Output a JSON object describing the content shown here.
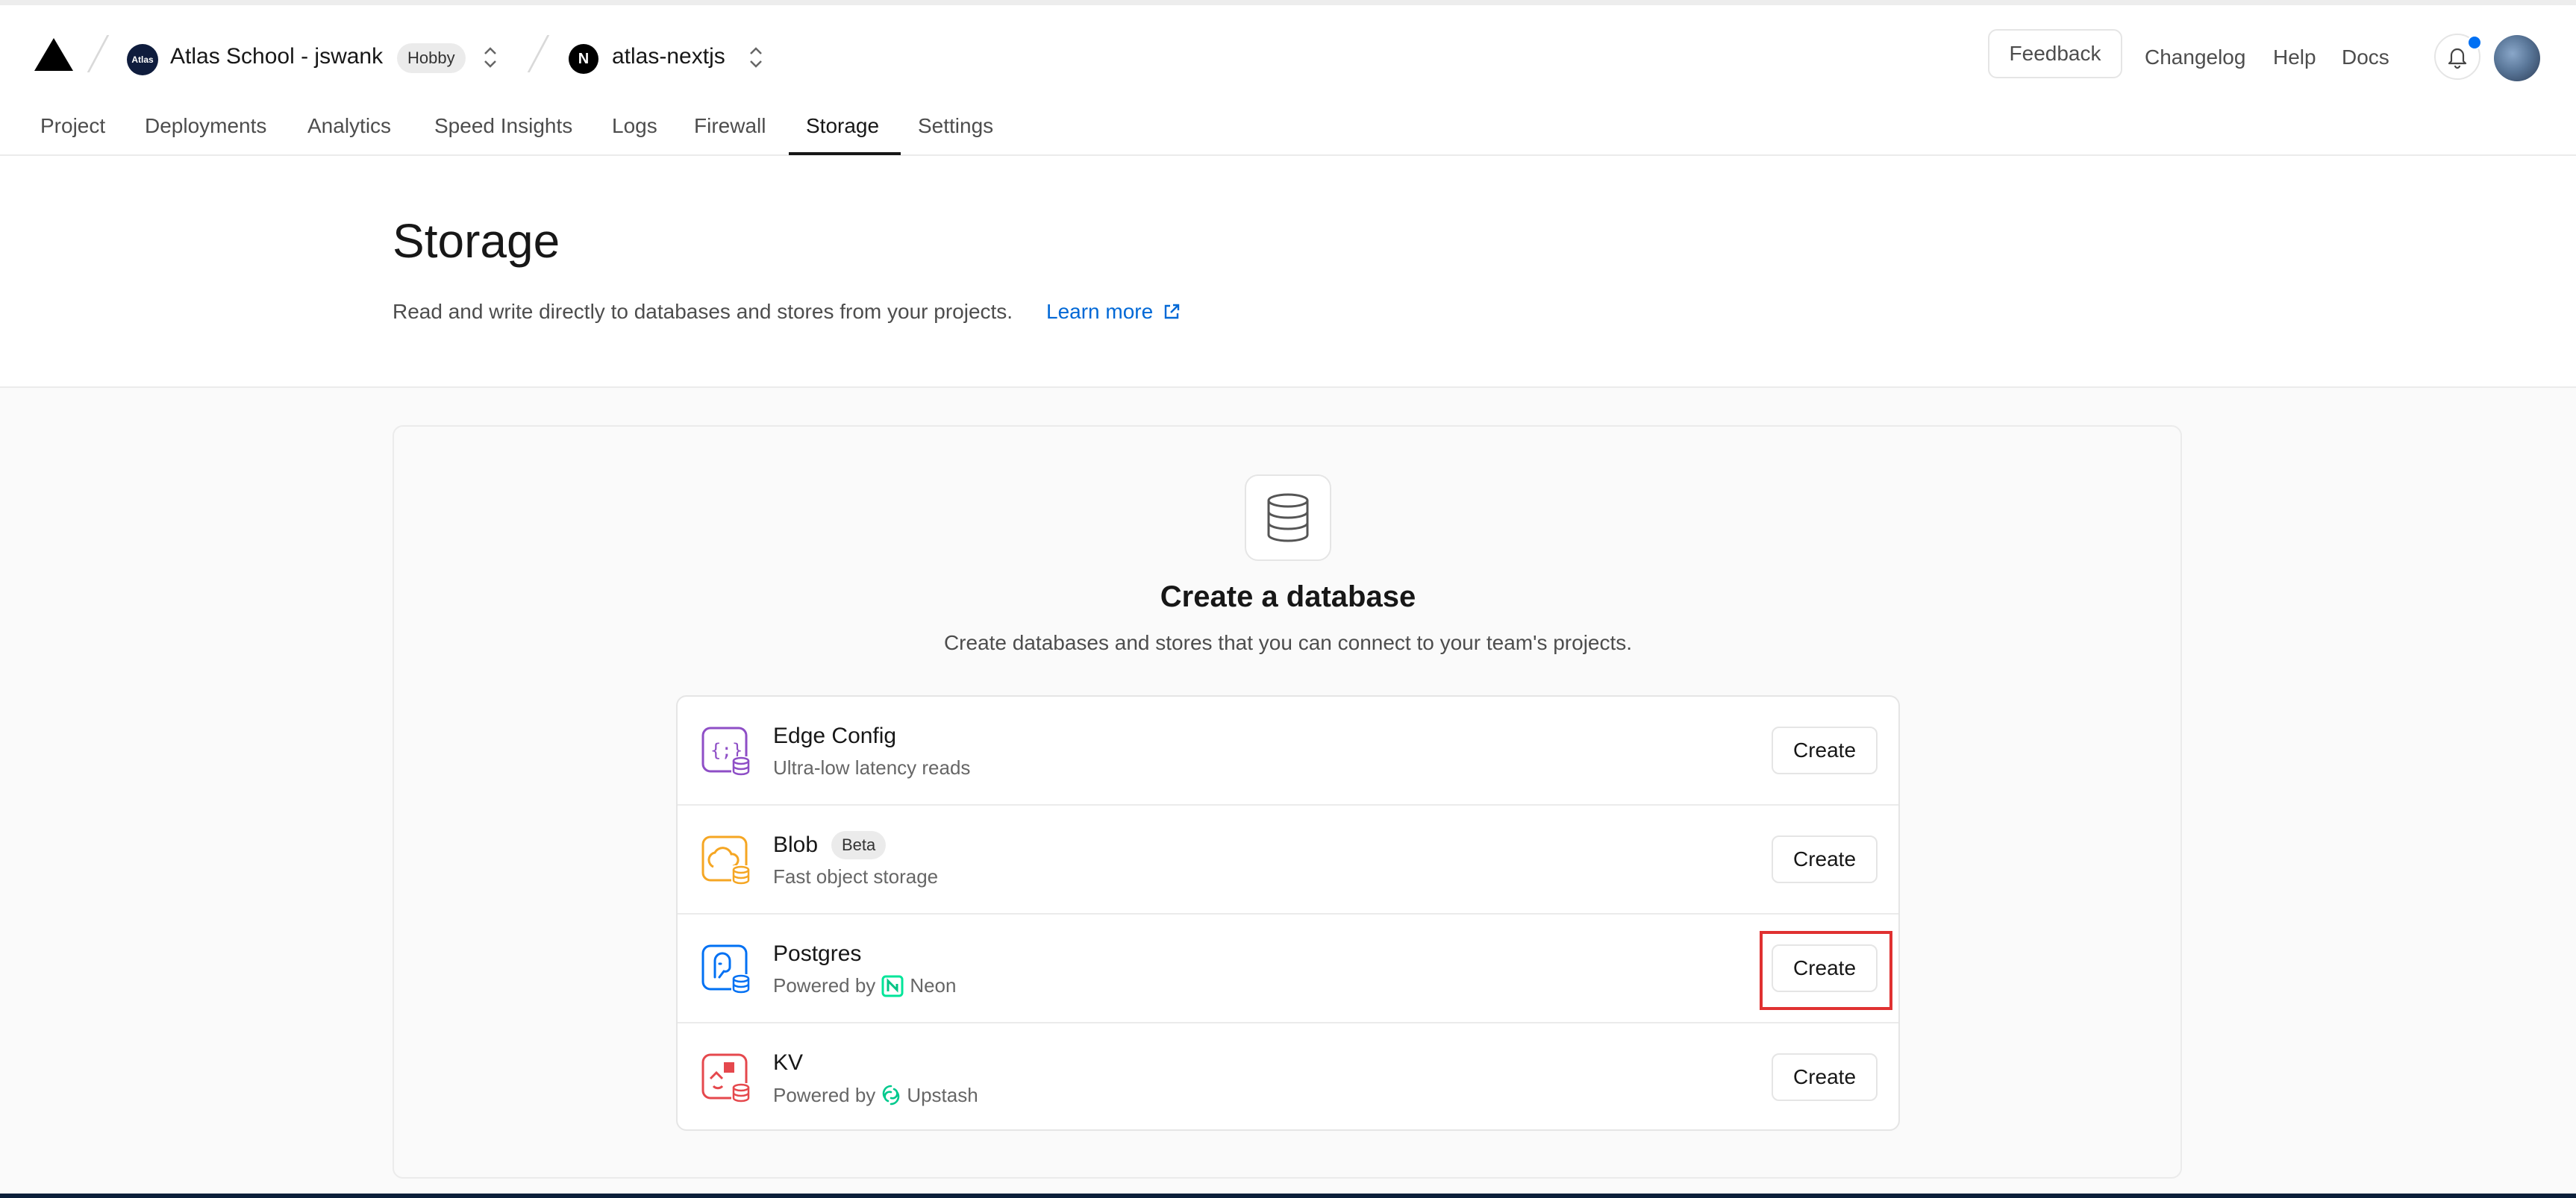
{
  "header": {
    "team": {
      "avatar_text": "Atlas",
      "name": "Atlas School - jswank",
      "plan_badge": "Hobby"
    },
    "project": {
      "avatar_text": "N",
      "name": "atlas-nextjs"
    },
    "actions": {
      "feedback": "Feedback",
      "changelog": "Changelog",
      "help": "Help",
      "docs": "Docs"
    }
  },
  "tabs": [
    {
      "label": "Project"
    },
    {
      "label": "Deployments"
    },
    {
      "label": "Analytics"
    },
    {
      "label": "Speed Insights"
    },
    {
      "label": "Logs"
    },
    {
      "label": "Firewall"
    },
    {
      "label": "Storage",
      "active": true
    },
    {
      "label": "Settings"
    }
  ],
  "page": {
    "title": "Storage",
    "description": "Read and write directly to databases and stores from your projects.",
    "learn_more": "Learn more"
  },
  "create_section": {
    "title": "Create a database",
    "description": "Create databases and stores that you can connect to your team's projects."
  },
  "databases": [
    {
      "name": "Edge Config",
      "subtitle": "Ultra-low latency reads",
      "button": "Create",
      "icon": "edge-config-icon",
      "color": "#8e4ec6"
    },
    {
      "name": "Blob",
      "badge": "Beta",
      "subtitle": "Fast object storage",
      "button": "Create",
      "icon": "blob-icon",
      "color": "#f5a623"
    },
    {
      "name": "Postgres",
      "subtitle_prefix": "Powered by",
      "provider": "Neon",
      "button": "Create",
      "icon": "postgres-icon",
      "color": "#0070f3",
      "highlighted": true
    },
    {
      "name": "KV",
      "subtitle_prefix": "Powered by",
      "provider": "Upstash",
      "button": "Create",
      "icon": "kv-icon",
      "color": "#e5484d"
    }
  ],
  "colors": {
    "link": "#0068d6",
    "highlight": "#e03131",
    "notification": "#0070f3"
  }
}
